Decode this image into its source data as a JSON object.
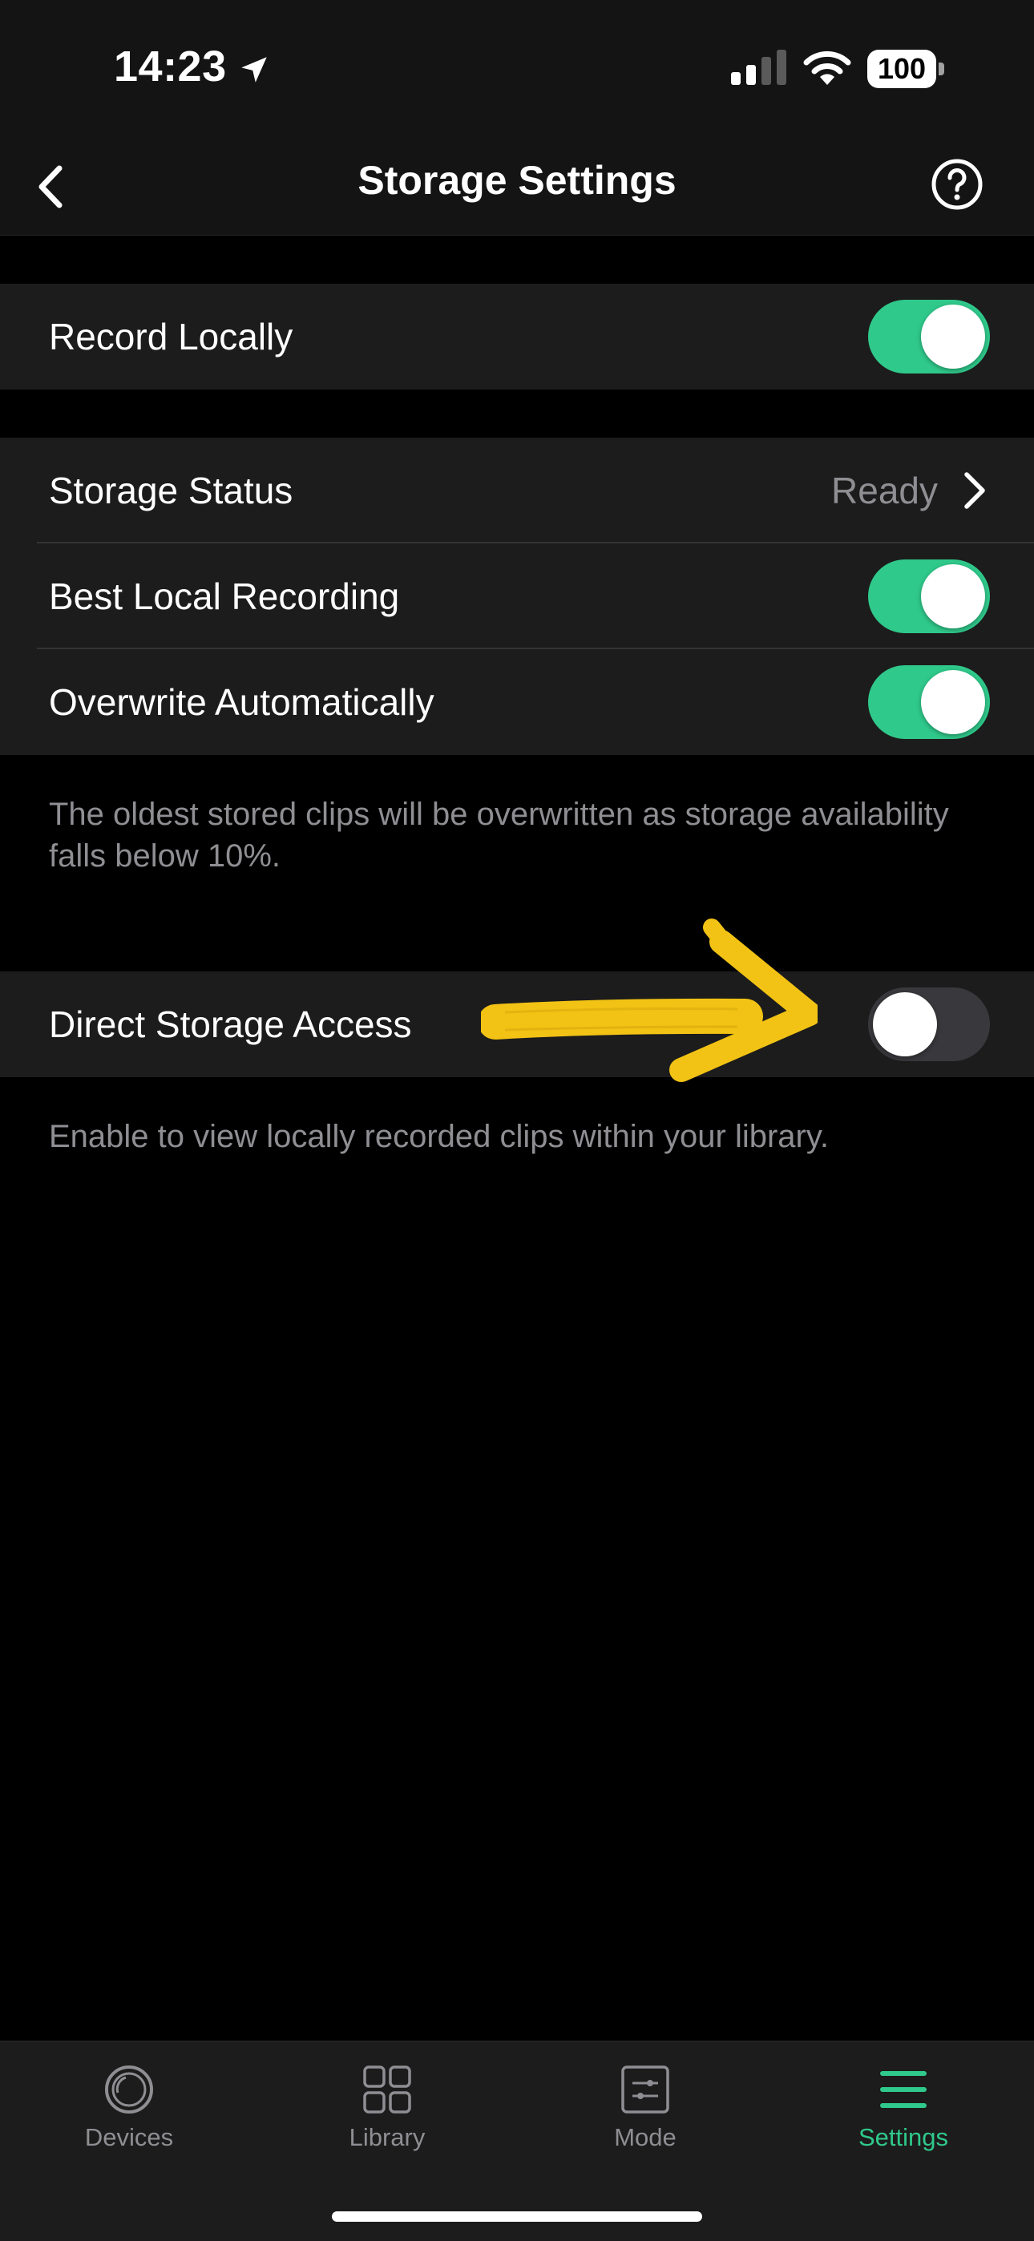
{
  "status_bar": {
    "time": "14:23",
    "battery": "100",
    "icons": [
      "location-arrow-icon",
      "cellular-signal-icon",
      "wifi-icon",
      "battery-icon"
    ]
  },
  "nav": {
    "title": "Storage Settings",
    "back_icon": "chevron-left-icon",
    "help_icon": "question-circle-icon"
  },
  "record_locally": {
    "label": "Record Locally",
    "enabled": true
  },
  "storage_group": {
    "status": {
      "label": "Storage Status",
      "value": "Ready"
    },
    "best_local": {
      "label": "Best Local Recording",
      "enabled": true
    },
    "overwrite": {
      "label": "Overwrite Automatically",
      "enabled": true
    },
    "note": "The oldest stored clips will be overwritten as storage availability falls below 10%."
  },
  "direct_access": {
    "label": "Direct Storage Access",
    "enabled": false,
    "note": "Enable to view locally recorded clips within your library."
  },
  "colors": {
    "accent": "#2fc98b",
    "toggle_off": "#39393d",
    "annotation_arrow": "#f2c314",
    "row_bg": "#1c1c1c",
    "secondary_text": "#8e8e93"
  },
  "tabs": [
    {
      "label": "Devices",
      "icon": "camera-lens-icon",
      "active": false
    },
    {
      "label": "Library",
      "icon": "grid-icon",
      "active": false
    },
    {
      "label": "Mode",
      "icon": "sliders-icon",
      "active": false
    },
    {
      "label": "Settings",
      "icon": "hamburger-menu-icon",
      "active": true
    }
  ]
}
